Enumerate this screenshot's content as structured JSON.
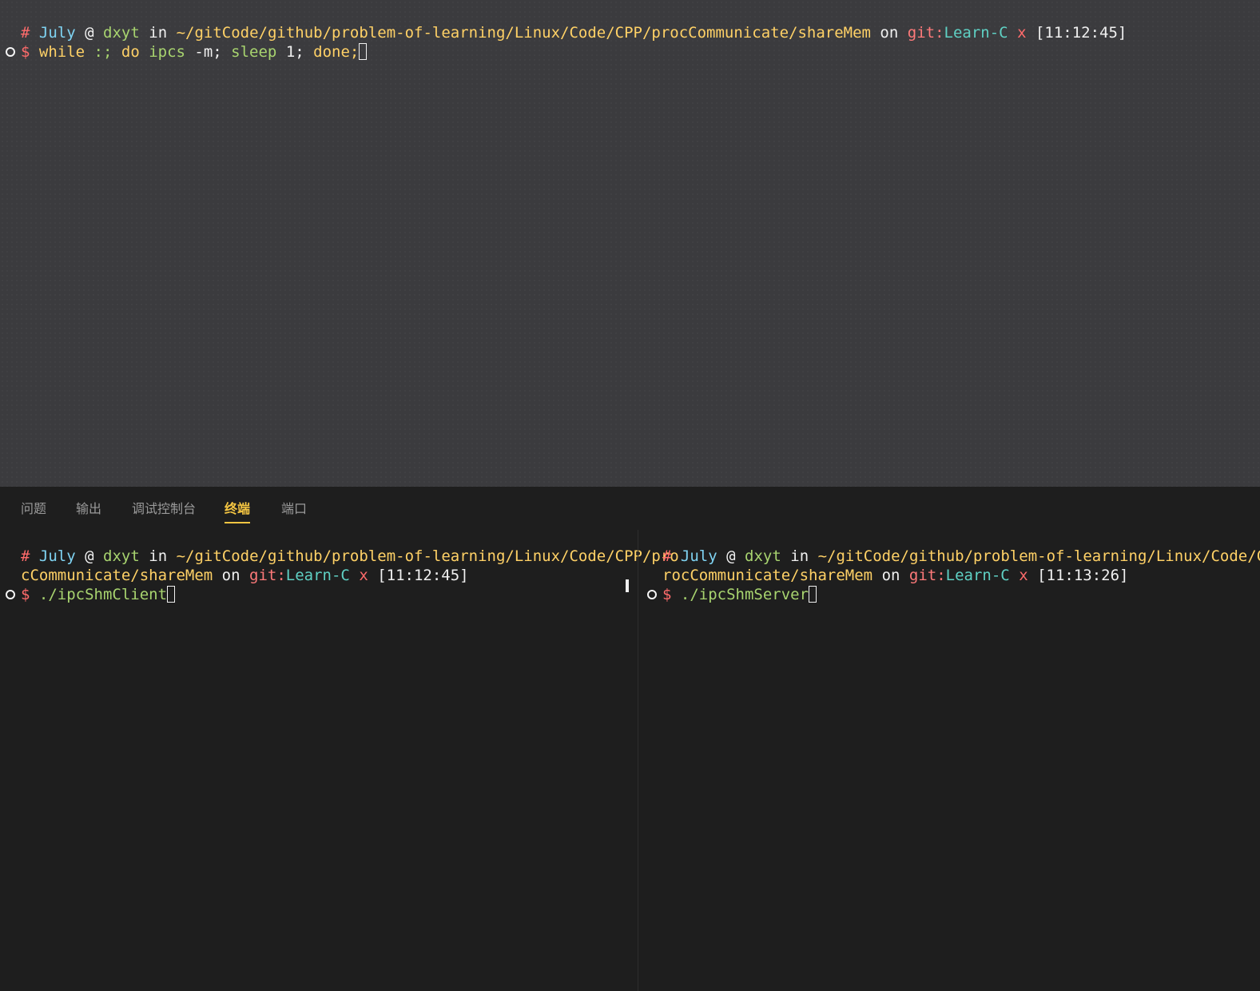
{
  "top_terminal": {
    "prompt": {
      "hash": "#",
      "user": "July",
      "at": "@",
      "host": "dxyt",
      "in": "in",
      "path": "~/gitCode/github/problem-of-learning/Linux/Code/CPP/procCommunicate/shareMem",
      "on": "on",
      "git": "git:",
      "branch": "Learn-C",
      "dirty": "x",
      "time": "[11:12:45]"
    },
    "command": {
      "dollar": "$",
      "w1": "while",
      "w2": " :;",
      "w3": " do",
      "w4": " ipcs",
      "w5": " -m;",
      "w6": " sleep",
      "w7": " 1;",
      "w8": " done;"
    }
  },
  "panel": {
    "tabs": [
      "问题",
      "输出",
      "调试控制台",
      "终端",
      "端口"
    ],
    "active_tab": "终端"
  },
  "left_terminal": {
    "prompt": {
      "hash": "#",
      "user": "July",
      "at": "@",
      "host": "dxyt",
      "in": "in",
      "path_line1": "~/gitCode/github/problem-of-learning/Linux/Code/CPP/pro",
      "path_line2": "cCommunicate/shareMem",
      "on": "on",
      "git": "git:",
      "branch": "Learn-C",
      "dirty": "x",
      "time": "[11:12:45]"
    },
    "command": {
      "dollar": "$",
      "text": "./ipcShmClient"
    }
  },
  "right_terminal": {
    "prompt": {
      "hash": "#",
      "user": "July",
      "at": "@",
      "host": "dxyt",
      "in": "in",
      "path_line1": "~/gitCode/github/problem-of-learning/Linux/Code/CPP/p",
      "path_line2": "rocCommunicate/shareMem",
      "on": "on",
      "git": "git:",
      "branch": "Learn-C",
      "dirty": "x",
      "time": "[11:13:26]"
    },
    "command": {
      "dollar": "$",
      "text": "./ipcShmServer"
    }
  }
}
